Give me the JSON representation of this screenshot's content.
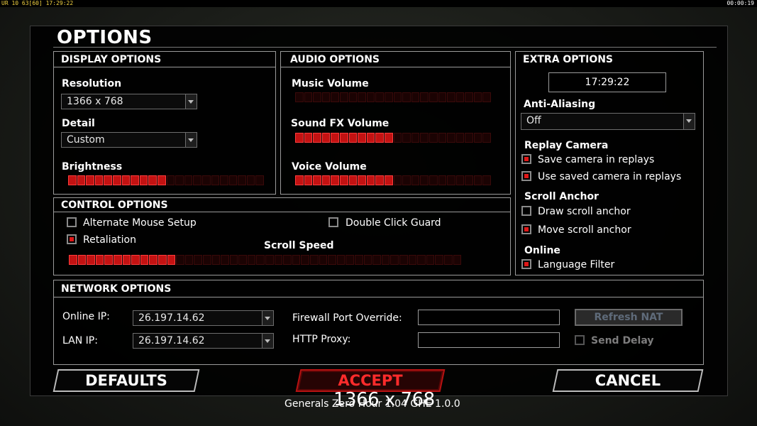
{
  "statusbar": {
    "left": "UR 10 63[60] 17:29:22",
    "right": "00:00:19"
  },
  "title": "OPTIONS",
  "display": {
    "header": "DISPLAY OPTIONS",
    "resolution_label": "Resolution",
    "resolution_value": "1366 x 768",
    "detail_label": "Detail",
    "detail_value": "Custom",
    "brightness_label": "Brightness",
    "brightness_level": 0.5
  },
  "audio": {
    "header": "AUDIO OPTIONS",
    "music_label": "Music Volume",
    "music_level": 0.0,
    "sfx_label": "Sound FX Volume",
    "sfx_level": 0.5,
    "voice_label": "Voice Volume",
    "voice_level": 0.5
  },
  "extra": {
    "header": "EXTRA OPTIONS",
    "clock": "17:29:22",
    "aa_label": "Anti-Aliasing",
    "aa_value": "Off",
    "replay_label": "Replay Camera",
    "save_camera": "Save camera in replays",
    "save_camera_checked": true,
    "use_camera": "Use saved camera in replays",
    "use_camera_checked": true,
    "scroll_label": "Scroll Anchor",
    "draw_anchor": "Draw scroll anchor",
    "draw_anchor_checked": false,
    "move_anchor": "Move scroll anchor",
    "move_anchor_checked": true,
    "online_label": "Online",
    "language_filter": "Language Filter",
    "language_filter_checked": true
  },
  "control": {
    "header": "CONTROL OPTIONS",
    "alt_mouse": "Alternate Mouse Setup",
    "alt_mouse_checked": false,
    "retaliation": "Retaliation",
    "retaliation_checked": true,
    "double_click": "Double Click Guard",
    "double_click_checked": false,
    "scroll_speed_label": "Scroll Speed",
    "scroll_speed_level": 0.28
  },
  "network": {
    "header": "NETWORK OPTIONS",
    "online_ip_label": "Online IP:",
    "online_ip_value": "26.197.14.62",
    "lan_ip_label": "LAN IP:",
    "lan_ip_value": "26.197.14.62",
    "firewall_label": "Firewall Port Override:",
    "firewall_value": "",
    "proxy_label": "HTTP Proxy:",
    "proxy_value": "",
    "refresh_nat": "Refresh NAT",
    "send_delay": "Send Delay",
    "send_delay_checked": false
  },
  "buttons": {
    "defaults": "DEFAULTS",
    "accept": "ACCEPT",
    "cancel": "CANCEL"
  },
  "footer": "Generals Zero Hour 1.04 GHE 1.0.0",
  "overlay_resolution": "1366 x 768",
  "colors": {
    "accent_red": "#c31212",
    "accept_red": "#ff2b2b"
  }
}
